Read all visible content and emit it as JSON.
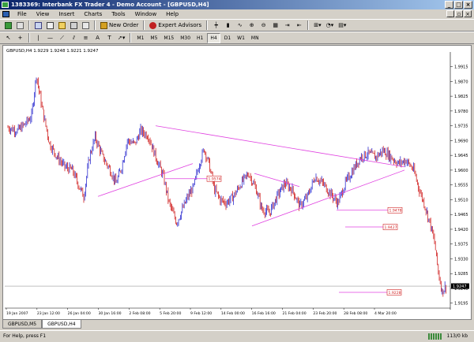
{
  "window": {
    "title": "1383369: Interbank FX Trader 4 - Demo Account - [GBPUSD,H4]"
  },
  "menu": [
    "File",
    "View",
    "Insert",
    "Charts",
    "Tools",
    "Window",
    "Help"
  ],
  "toolbar": {
    "new_order": "New Order",
    "expert_advisors": "Expert Advisors"
  },
  "timeframes": [
    "M1",
    "M5",
    "M15",
    "M30",
    "H1",
    "H4",
    "D1",
    "W1",
    "MN"
  ],
  "active_timeframe": "H4",
  "chart": {
    "header": "GBPUSD,H4  1.9229 1.9248 1.9221 1.9247"
  },
  "chart_data": {
    "type": "bar",
    "symbol": "GBPUSD,H4",
    "ohlc_readout": "1.9229 1.9248 1.9221 1.9247",
    "y_ticks": [
      "1.9915",
      "1.9870",
      "1.9825",
      "1.9780",
      "1.9735",
      "1.9690",
      "1.9645",
      "1.9600",
      "1.9555",
      "1.9510",
      "1.9465",
      "1.9420",
      "1.9375",
      "1.9330",
      "1.9285",
      "1.9240",
      "1.9195"
    ],
    "x_ticks": [
      "19 Jan 2007",
      "23 Jan 12:00",
      "26 Jan 04:00",
      "30 Jan 16:00",
      "2 Feb 08:00",
      "5 Feb 20:00",
      "9 Feb 12:00",
      "14 Feb 00:00",
      "16 Feb 16:00",
      "21 Feb 04:00",
      "23 Feb 20:00",
      "28 Feb 08:00",
      "4 Mar 20:00"
    ],
    "ylim": [
      1.918,
      1.995
    ],
    "bid_price": "1.9247",
    "price_labels": [
      "1.9574",
      "1.9478",
      "1.9427",
      "1.9228"
    ],
    "colors": {
      "bull": "#3030d0",
      "bear": "#d02020",
      "trendline": "#e040e0",
      "bidline": "#808080"
    }
  },
  "tabs": [
    "GBPUSD,M5",
    "GBPUSD,H4"
  ],
  "active_tab": "GBPUSD,H4",
  "status": {
    "left": "For Help, press F1",
    "right": "113/0 kb"
  }
}
